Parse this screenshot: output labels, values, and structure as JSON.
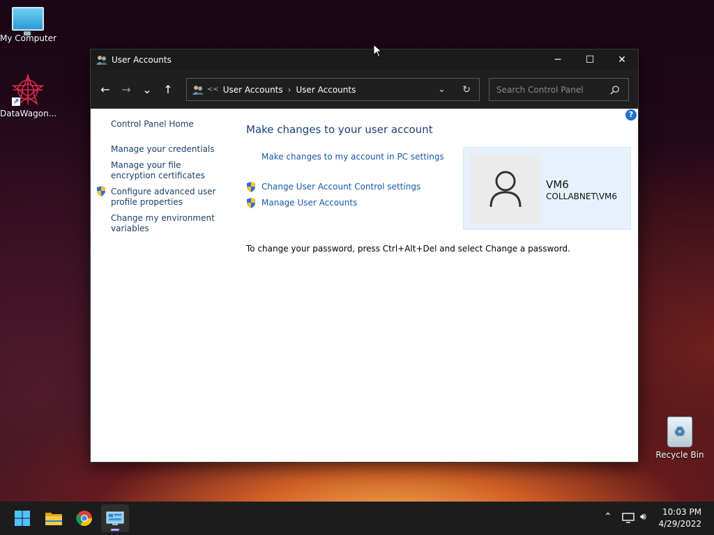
{
  "desktop": {
    "icons": [
      {
        "label": "My Computer"
      },
      {
        "label": "DataWagon..."
      },
      {
        "label": "Recycle Bin"
      }
    ]
  },
  "window": {
    "title": "User Accounts",
    "controls": {
      "minimize": "─",
      "maximize": "☐",
      "close": "✕"
    },
    "nav": {
      "back": "←",
      "forward": "→",
      "recent": "⌄",
      "up": "↑"
    },
    "address": {
      "overflow": "<<",
      "crumbs": [
        "User Accounts",
        "User Accounts"
      ],
      "separator": "›"
    },
    "search": {
      "placeholder": "Search Control Panel"
    },
    "help": "?",
    "left_nav": {
      "home": "Control Panel Home",
      "items": [
        "Manage your credentials",
        "Manage your file encryption certificates",
        "Configure advanced user profile properties",
        "Change my environment variables"
      ]
    },
    "main": {
      "heading": "Make changes to your user account",
      "links": [
        "Make changes to my account in PC settings",
        "Change User Account Control settings",
        "Manage User Accounts"
      ],
      "note": "To change your password, press Ctrl+Alt+Del and select Change a password."
    },
    "user": {
      "name": "VM6",
      "domain": "COLLABNET\\VM6"
    }
  },
  "taskbar": {
    "apps": [
      "start-icon",
      "file-explorer-icon",
      "chrome-icon",
      "control-panel-icon"
    ],
    "clock": {
      "time": "10:03 PM",
      "date": "4/29/2022"
    }
  },
  "colors": {
    "link": "#1757a8",
    "heading": "#1c3d7a",
    "titlebar": "#1b1b1b",
    "accent": "#1e73d1"
  }
}
